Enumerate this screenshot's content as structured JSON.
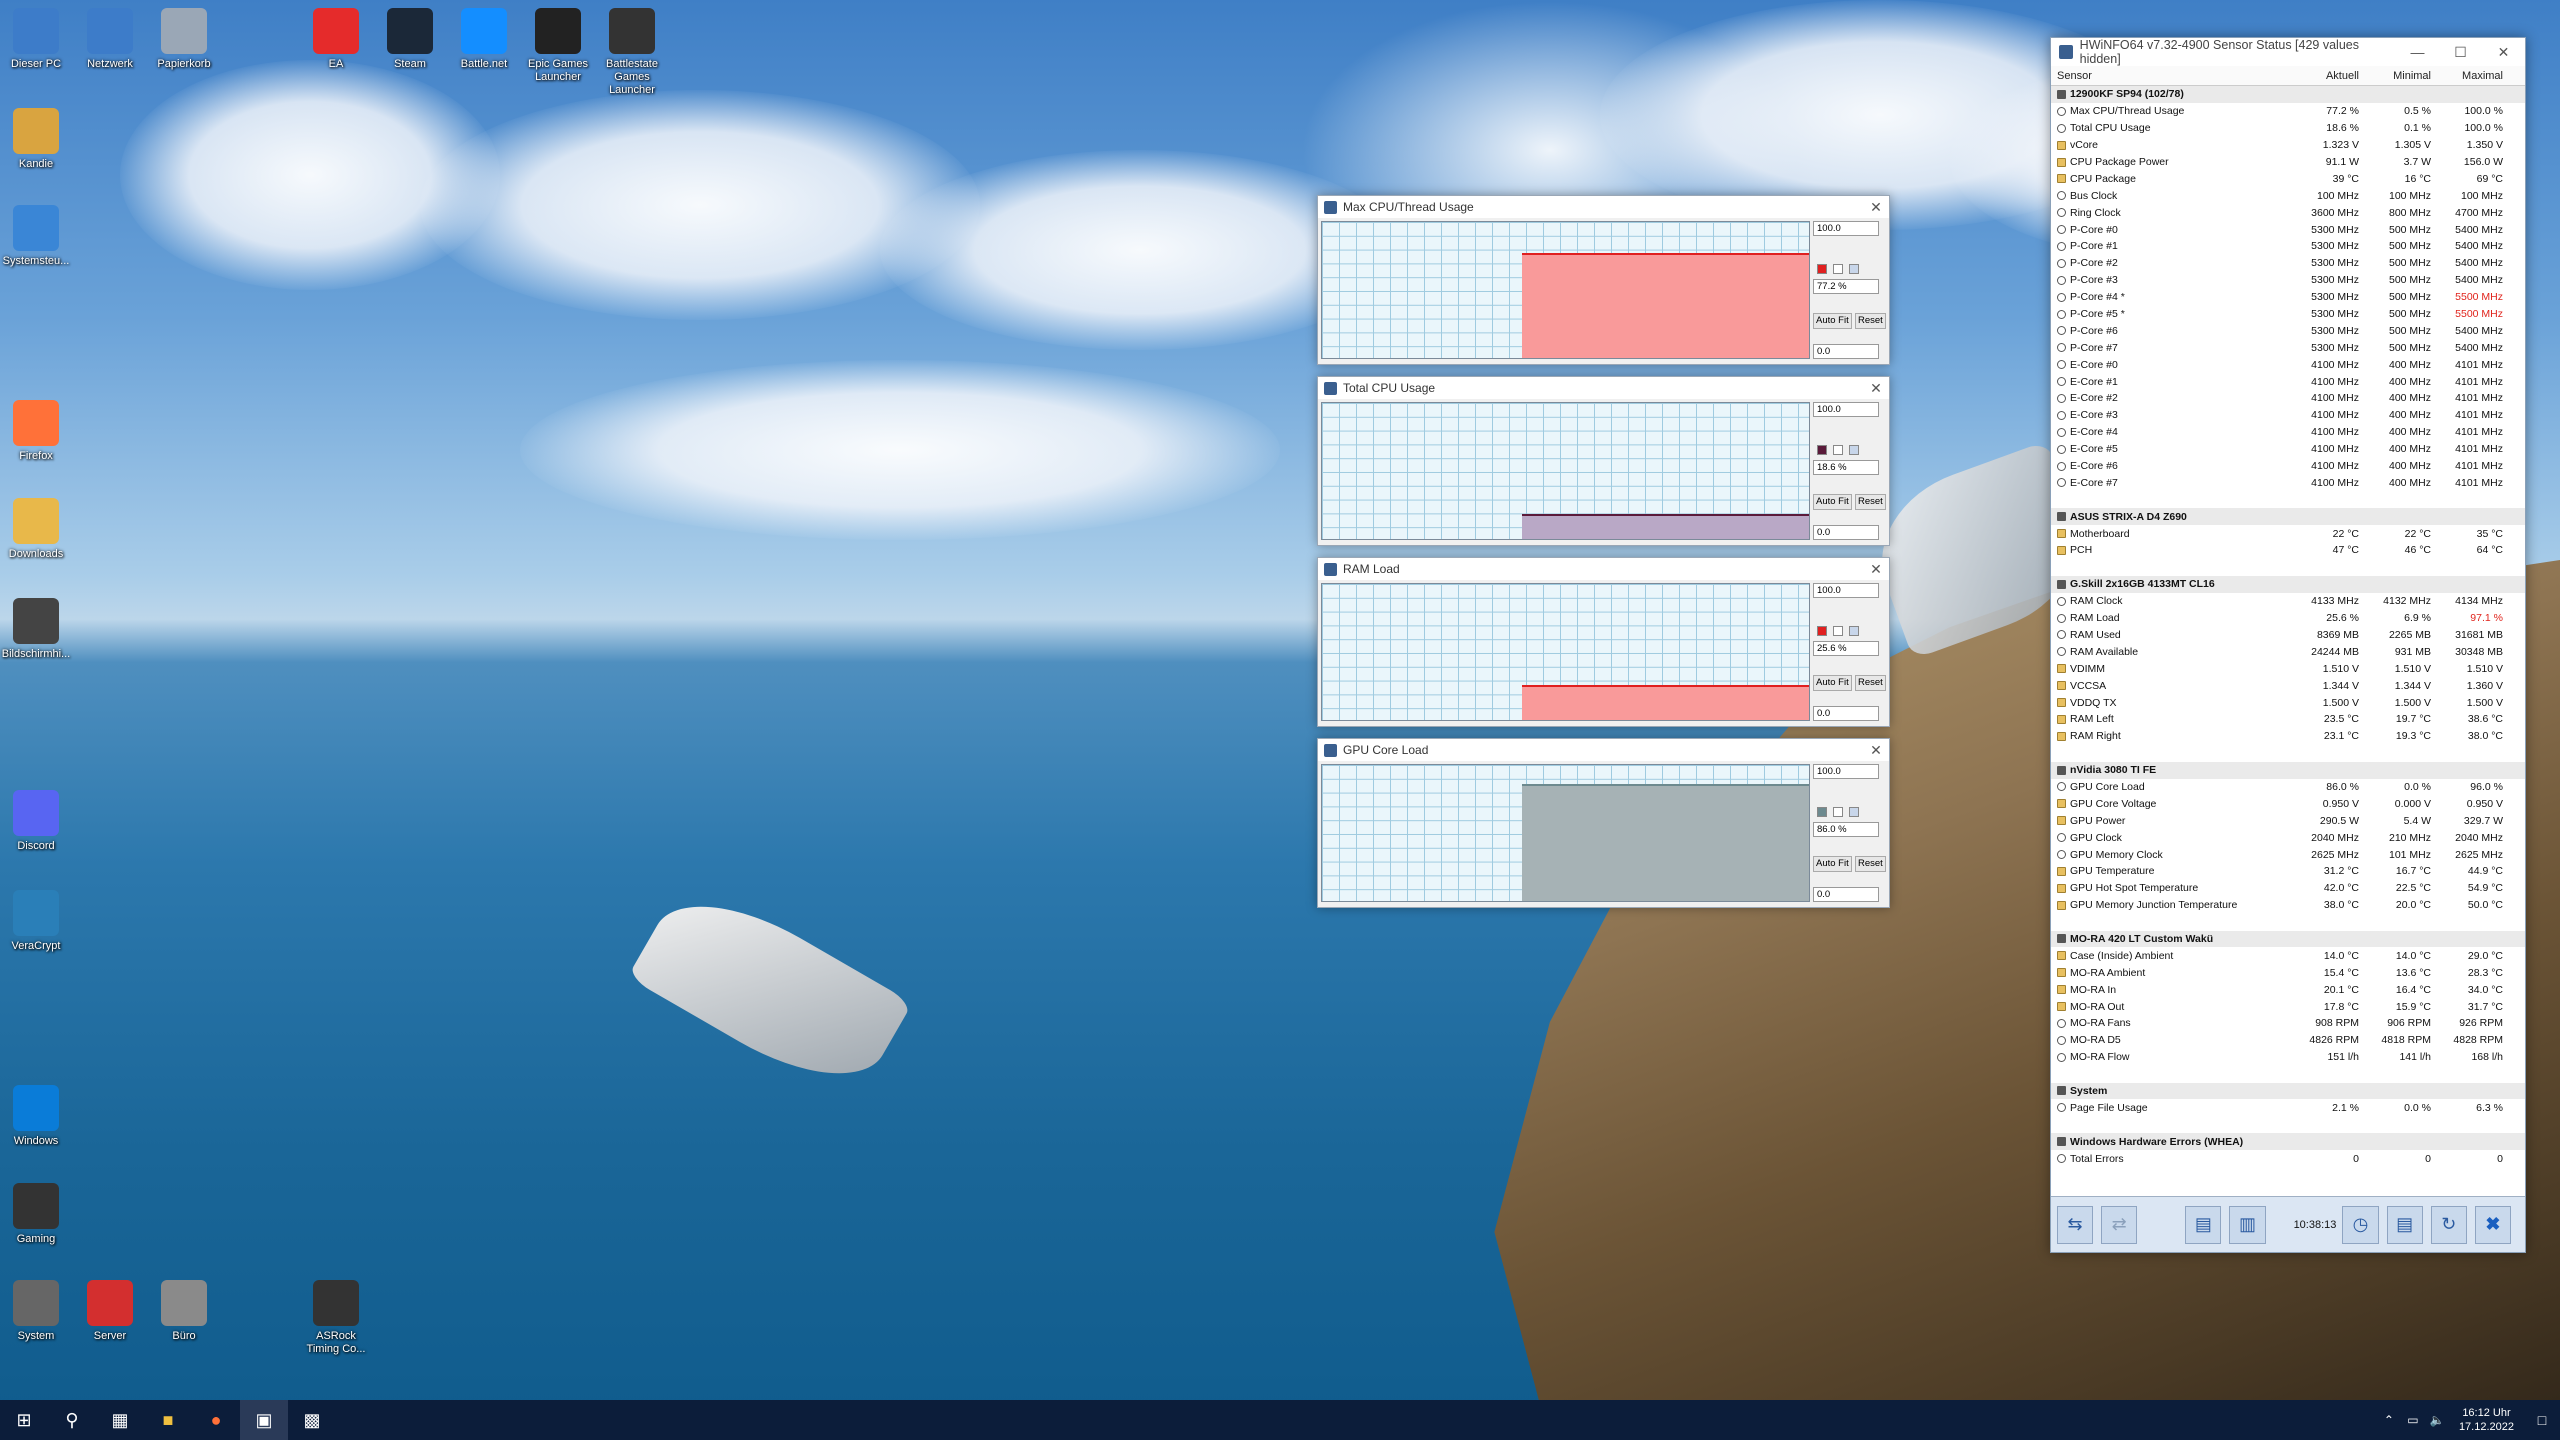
{
  "desktop": {
    "icons": [
      {
        "label": "Dieser PC",
        "icon": "computer-icon",
        "color": "#3d7cc9"
      },
      {
        "label": "Netzwerk",
        "icon": "network-icon",
        "color": "#3d7cc9"
      },
      {
        "label": "Papierkorb",
        "icon": "recycle-bin-icon",
        "color": "#9aa7b6"
      },
      {
        "label": "EA",
        "icon": "ea-icon",
        "color": "#e52b2b"
      },
      {
        "label": "Steam",
        "icon": "steam-icon",
        "color": "#1b2838"
      },
      {
        "label": "Battle.net",
        "icon": "battlenet-icon",
        "color": "#148eff"
      },
      {
        "label": "Epic Games Launcher",
        "icon": "epic-icon",
        "color": "#222222"
      },
      {
        "label": "Battlestate Games Launcher",
        "icon": "battlestate-icon",
        "color": "#333333"
      },
      {
        "label": "Kandie",
        "icon": "user-folder-icon",
        "color": "#d9a440"
      },
      {
        "label": "Systemsteu...",
        "icon": "control-panel-icon",
        "color": "#3a86d6"
      },
      {
        "label": "Firefox",
        "icon": "firefox-icon",
        "color": "#ff7139"
      },
      {
        "label": "Downloads",
        "icon": "downloads-icon",
        "color": "#e8b84a"
      },
      {
        "label": "Bildschirmhi...",
        "icon": "screensaver-icon",
        "color": "#444444"
      },
      {
        "label": "Discord",
        "icon": "discord-icon",
        "color": "#5865f2"
      },
      {
        "label": "VeraCrypt",
        "icon": "veracrypt-icon",
        "color": "#2a7fb8"
      },
      {
        "label": "Windows",
        "icon": "windows-icon",
        "color": "#0a7cd8"
      },
      {
        "label": "Gaming",
        "icon": "mouse-icon",
        "color": "#333333"
      },
      {
        "label": "System",
        "icon": "gear-icon",
        "color": "#666666"
      },
      {
        "label": "Server",
        "icon": "terminal-icon",
        "color": "#d32f2f"
      },
      {
        "label": "Büro",
        "icon": "notepad-icon",
        "color": "#8a8a8a"
      },
      {
        "label": "ASRock Timing Co...",
        "icon": "asrock-icon",
        "color": "#333333"
      }
    ]
  },
  "graphs": [
    {
      "title": "Max CPU/Thread Usage",
      "max": "100.0",
      "current": "77.2 %",
      "min": "0.0",
      "value": 0.772,
      "autofit": "Auto Fit",
      "reset": "Reset",
      "color": "#f99a9a",
      "sq": "#e02020"
    },
    {
      "title": "Total CPU Usage",
      "max": "100.0",
      "current": "18.6 %",
      "min": "0.0",
      "value": 0.186,
      "autofit": "Auto Fit",
      "reset": "Reset",
      "color": "#b9a8c6",
      "sq": "#5a1a3a"
    },
    {
      "title": "RAM Load",
      "max": "100.0",
      "current": "25.6 %",
      "min": "0.0",
      "value": 0.256,
      "autofit": "Auto Fit",
      "reset": "Reset",
      "color": "#f99a9a",
      "sq": "#e02020"
    },
    {
      "title": "GPU Core Load",
      "max": "100.0",
      "current": "86.0 %",
      "min": "0.0",
      "value": 0.86,
      "autofit": "Auto Fit",
      "reset": "Reset",
      "color": "#a6b2b5",
      "sq": "#6d8a8f"
    }
  ],
  "hwinfo": {
    "title": "HWiNFO64 v7.32-4900 Sensor Status [429 values hidden]",
    "headers": [
      "Sensor",
      "Aktuell",
      "Minimal",
      "Maximal"
    ],
    "rows": [
      {
        "g": 1,
        "n": "12900KF SP94 (102/78)"
      },
      {
        "n": "Max CPU/Thread Usage",
        "a": "77.2 %",
        "mi": "0.5 %",
        "ma": "100.0 %"
      },
      {
        "n": "Total CPU Usage",
        "a": "18.6 %",
        "mi": "0.1 %",
        "ma": "100.0 %"
      },
      {
        "n": "vCore",
        "a": "1.323 V",
        "mi": "1.305 V",
        "ma": "1.350 V",
        "t": 1
      },
      {
        "n": "CPU Package Power",
        "a": "91.1 W",
        "mi": "3.7 W",
        "ma": "156.0 W",
        "t": 1
      },
      {
        "n": "CPU Package",
        "a": "39 °C",
        "mi": "16 °C",
        "ma": "69 °C",
        "t": 1
      },
      {
        "n": "Bus Clock",
        "a": "100 MHz",
        "mi": "100 MHz",
        "ma": "100 MHz"
      },
      {
        "n": "Ring Clock",
        "a": "3600 MHz",
        "mi": "800 MHz",
        "ma": "4700 MHz"
      },
      {
        "n": "P-Core #0",
        "a": "5300 MHz",
        "mi": "500 MHz",
        "ma": "5400 MHz"
      },
      {
        "n": "P-Core #1",
        "a": "5300 MHz",
        "mi": "500 MHz",
        "ma": "5400 MHz"
      },
      {
        "n": "P-Core #2",
        "a": "5300 MHz",
        "mi": "500 MHz",
        "ma": "5400 MHz"
      },
      {
        "n": "P-Core #3",
        "a": "5300 MHz",
        "mi": "500 MHz",
        "ma": "5400 MHz"
      },
      {
        "n": "P-Core #4 *",
        "a": "5300 MHz",
        "mi": "500 MHz",
        "ma": "5500 MHz",
        "r": 1
      },
      {
        "n": "P-Core #5 *",
        "a": "5300 MHz",
        "mi": "500 MHz",
        "ma": "5500 MHz",
        "r": 1
      },
      {
        "n": "P-Core #6",
        "a": "5300 MHz",
        "mi": "500 MHz",
        "ma": "5400 MHz"
      },
      {
        "n": "P-Core #7",
        "a": "5300 MHz",
        "mi": "500 MHz",
        "ma": "5400 MHz"
      },
      {
        "n": "E-Core #0",
        "a": "4100 MHz",
        "mi": "400 MHz",
        "ma": "4101 MHz"
      },
      {
        "n": "E-Core #1",
        "a": "4100 MHz",
        "mi": "400 MHz",
        "ma": "4101 MHz"
      },
      {
        "n": "E-Core #2",
        "a": "4100 MHz",
        "mi": "400 MHz",
        "ma": "4101 MHz"
      },
      {
        "n": "E-Core #3",
        "a": "4100 MHz",
        "mi": "400 MHz",
        "ma": "4101 MHz"
      },
      {
        "n": "E-Core #4",
        "a": "4100 MHz",
        "mi": "400 MHz",
        "ma": "4101 MHz"
      },
      {
        "n": "E-Core #5",
        "a": "4100 MHz",
        "mi": "400 MHz",
        "ma": "4101 MHz"
      },
      {
        "n": "E-Core #6",
        "a": "4100 MHz",
        "mi": "400 MHz",
        "ma": "4101 MHz"
      },
      {
        "n": "E-Core #7",
        "a": "4100 MHz",
        "mi": "400 MHz",
        "ma": "4101 MHz"
      },
      {
        "e": 1
      },
      {
        "g": 1,
        "n": "ASUS STRIX-A D4 Z690"
      },
      {
        "n": "Motherboard",
        "a": "22 °C",
        "mi": "22 °C",
        "ma": "35 °C",
        "t": 1
      },
      {
        "n": "PCH",
        "a": "47 °C",
        "mi": "46 °C",
        "ma": "64 °C",
        "t": 1
      },
      {
        "e": 1
      },
      {
        "g": 1,
        "n": "G.Skill 2x16GB 4133MT CL16"
      },
      {
        "n": "RAM Clock",
        "a": "4133 MHz",
        "mi": "4132 MHz",
        "ma": "4134 MHz"
      },
      {
        "n": "RAM Load",
        "a": "25.6 %",
        "mi": "6.9 %",
        "ma": "97.1 %",
        "r": 1
      },
      {
        "n": "RAM Used",
        "a": "8369 MB",
        "mi": "2265 MB",
        "ma": "31681 MB"
      },
      {
        "n": "RAM Available",
        "a": "24244 MB",
        "mi": "931 MB",
        "ma": "30348 MB"
      },
      {
        "n": "VDIMM",
        "a": "1.510 V",
        "mi": "1.510 V",
        "ma": "1.510 V",
        "t": 1
      },
      {
        "n": "VCCSA",
        "a": "1.344 V",
        "mi": "1.344 V",
        "ma": "1.360 V",
        "t": 1
      },
      {
        "n": "VDDQ TX",
        "a": "1.500 V",
        "mi": "1.500 V",
        "ma": "1.500 V",
        "t": 1
      },
      {
        "n": "RAM Left",
        "a": "23.5 °C",
        "mi": "19.7 °C",
        "ma": "38.6 °C",
        "t": 1
      },
      {
        "n": "RAM Right",
        "a": "23.1 °C",
        "mi": "19.3 °C",
        "ma": "38.0 °C",
        "t": 1
      },
      {
        "e": 1
      },
      {
        "g": 1,
        "n": "nVidia 3080 TI FE"
      },
      {
        "n": "GPU Core Load",
        "a": "86.0 %",
        "mi": "0.0 %",
        "ma": "96.0 %"
      },
      {
        "n": "GPU Core Voltage",
        "a": "0.950 V",
        "mi": "0.000 V",
        "ma": "0.950 V",
        "t": 1
      },
      {
        "n": "GPU Power",
        "a": "290.5 W",
        "mi": "5.4 W",
        "ma": "329.7 W",
        "t": 1
      },
      {
        "n": "GPU Clock",
        "a": "2040 MHz",
        "mi": "210 MHz",
        "ma": "2040 MHz"
      },
      {
        "n": "GPU Memory Clock",
        "a": "2625 MHz",
        "mi": "101 MHz",
        "ma": "2625 MHz"
      },
      {
        "n": "GPU Temperature",
        "a": "31.2 °C",
        "mi": "16.7 °C",
        "ma": "44.9 °C",
        "t": 1
      },
      {
        "n": "GPU Hot Spot Temperature",
        "a": "42.0 °C",
        "mi": "22.5 °C",
        "ma": "54.9 °C",
        "t": 1
      },
      {
        "n": "GPU Memory Junction Temperature",
        "a": "38.0 °C",
        "mi": "20.0 °C",
        "ma": "50.0 °C",
        "t": 1
      },
      {
        "e": 1
      },
      {
        "g": 1,
        "n": "MO-RA 420 LT Custom Wakü"
      },
      {
        "n": "Case (Inside) Ambient",
        "a": "14.0 °C",
        "mi": "14.0 °C",
        "ma": "29.0 °C",
        "t": 1
      },
      {
        "n": "MO-RA Ambient",
        "a": "15.4 °C",
        "mi": "13.6 °C",
        "ma": "28.3 °C",
        "t": 1
      },
      {
        "n": "MO-RA In",
        "a": "20.1 °C",
        "mi": "16.4 °C",
        "ma": "34.0 °C",
        "t": 1
      },
      {
        "n": "MO-RA Out",
        "a": "17.8 °C",
        "mi": "15.9 °C",
        "ma": "31.7 °C",
        "t": 1
      },
      {
        "n": "MO-RA Fans",
        "a": "908 RPM",
        "mi": "906 RPM",
        "ma": "926 RPM"
      },
      {
        "n": "MO-RA D5",
        "a": "4826 RPM",
        "mi": "4818 RPM",
        "ma": "4828 RPM"
      },
      {
        "n": "MO-RA Flow",
        "a": "151 l/h",
        "mi": "141 l/h",
        "ma": "168 l/h"
      },
      {
        "e": 1
      },
      {
        "g": 1,
        "n": "System"
      },
      {
        "n": "Page File Usage",
        "a": "2.1 %",
        "mi": "0.0 %",
        "ma": "6.3 %"
      },
      {
        "e": 1
      },
      {
        "g": 1,
        "n": "Windows Hardware Errors (WHEA)"
      },
      {
        "n": "Total Errors",
        "a": "0",
        "mi": "0",
        "ma": "0"
      }
    ],
    "time": "10:38:13"
  },
  "taskbar": {
    "time": "16:12 Uhr",
    "date": "17.12.2022"
  }
}
